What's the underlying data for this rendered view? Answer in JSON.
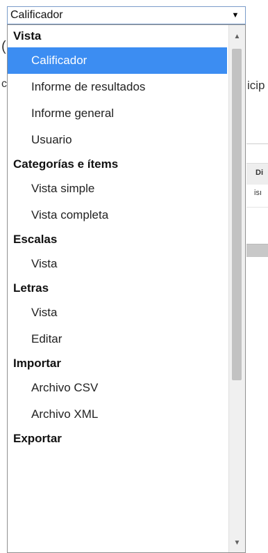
{
  "select": {
    "value": "Calificador",
    "arrow_icon": "triangle-down-icon"
  },
  "background": {
    "paren": "(",
    "letter_c": "c",
    "icip": "icip",
    "dir": "Di",
    "is": "isı"
  },
  "dropdown": {
    "groups": [
      {
        "label": "Vista",
        "options": [
          "Calificador",
          "Informe de resultados",
          "Informe general",
          "Usuario"
        ]
      },
      {
        "label": "Categorías e ítems",
        "options": [
          "Vista simple",
          "Vista completa"
        ]
      },
      {
        "label": "Escalas",
        "options": [
          "Vista"
        ]
      },
      {
        "label": "Letras",
        "options": [
          "Vista",
          "Editar"
        ]
      },
      {
        "label": "Importar",
        "options": [
          "Archivo CSV",
          "Archivo XML"
        ]
      },
      {
        "label": "Exportar",
        "options": []
      }
    ],
    "selected": "Calificador",
    "selected_color": "#3c8df2"
  },
  "scrollbar": {
    "up_icon": "scroll-up-arrow-icon",
    "down_icon": "scroll-down-arrow-icon"
  }
}
